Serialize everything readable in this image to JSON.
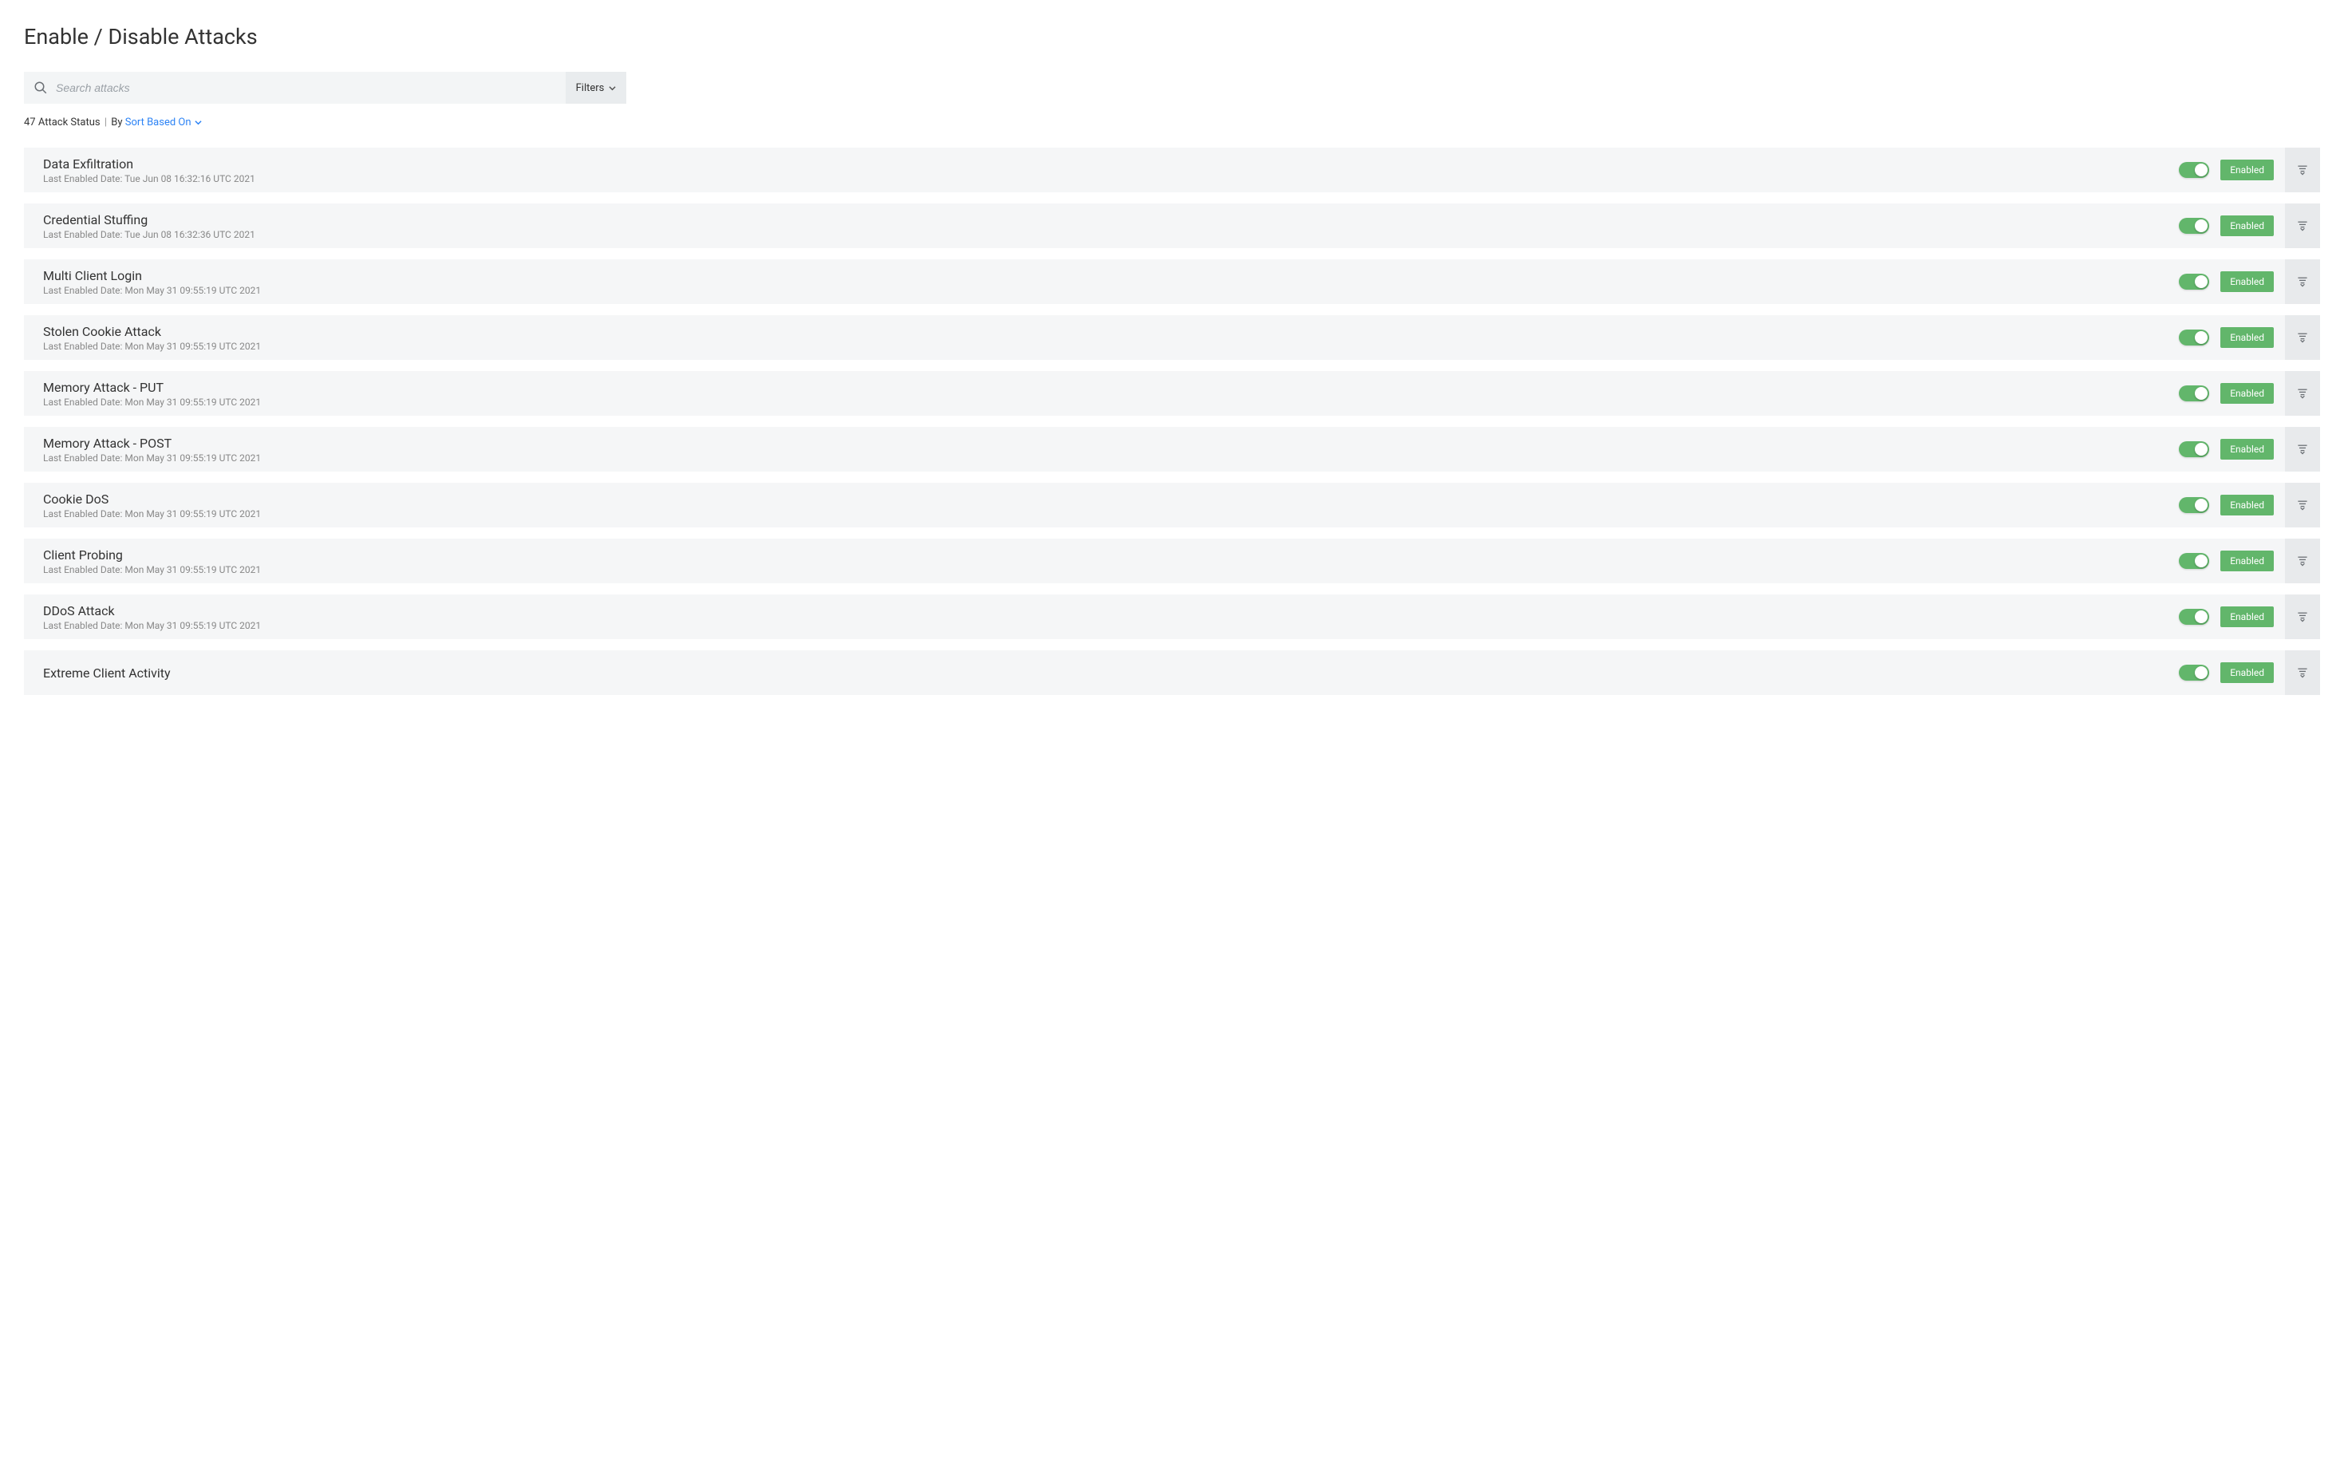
{
  "page_title": "Enable / Disable Attacks",
  "search": {
    "placeholder": "Search attacks"
  },
  "filters_label": "Filters",
  "status": {
    "count": "47",
    "status_label": "Attack Status",
    "by_label": "By",
    "sort_label": "Sort Based On"
  },
  "date_prefix": "Last Enabled Date: ",
  "enabled_label": "Enabled",
  "attacks": [
    {
      "name": "Data Exfiltration",
      "date": "Tue Jun 08 16:32:16 UTC 2021",
      "enabled": true
    },
    {
      "name": "Credential Stuffing",
      "date": "Tue Jun 08 16:32:36 UTC 2021",
      "enabled": true
    },
    {
      "name": "Multi Client Login",
      "date": "Mon May 31 09:55:19 UTC 2021",
      "enabled": true
    },
    {
      "name": "Stolen Cookie Attack",
      "date": "Mon May 31 09:55:19 UTC 2021",
      "enabled": true
    },
    {
      "name": "Memory Attack - PUT",
      "date": "Mon May 31 09:55:19 UTC 2021",
      "enabled": true
    },
    {
      "name": "Memory Attack - POST",
      "date": "Mon May 31 09:55:19 UTC 2021",
      "enabled": true
    },
    {
      "name": "Cookie DoS",
      "date": "Mon May 31 09:55:19 UTC 2021",
      "enabled": true
    },
    {
      "name": "Client Probing",
      "date": "Mon May 31 09:55:19 UTC 2021",
      "enabled": true
    },
    {
      "name": "DDoS Attack",
      "date": "Mon May 31 09:55:19 UTC 2021",
      "enabled": true
    },
    {
      "name": "Extreme Client Activity",
      "date": "",
      "enabled": true
    }
  ]
}
